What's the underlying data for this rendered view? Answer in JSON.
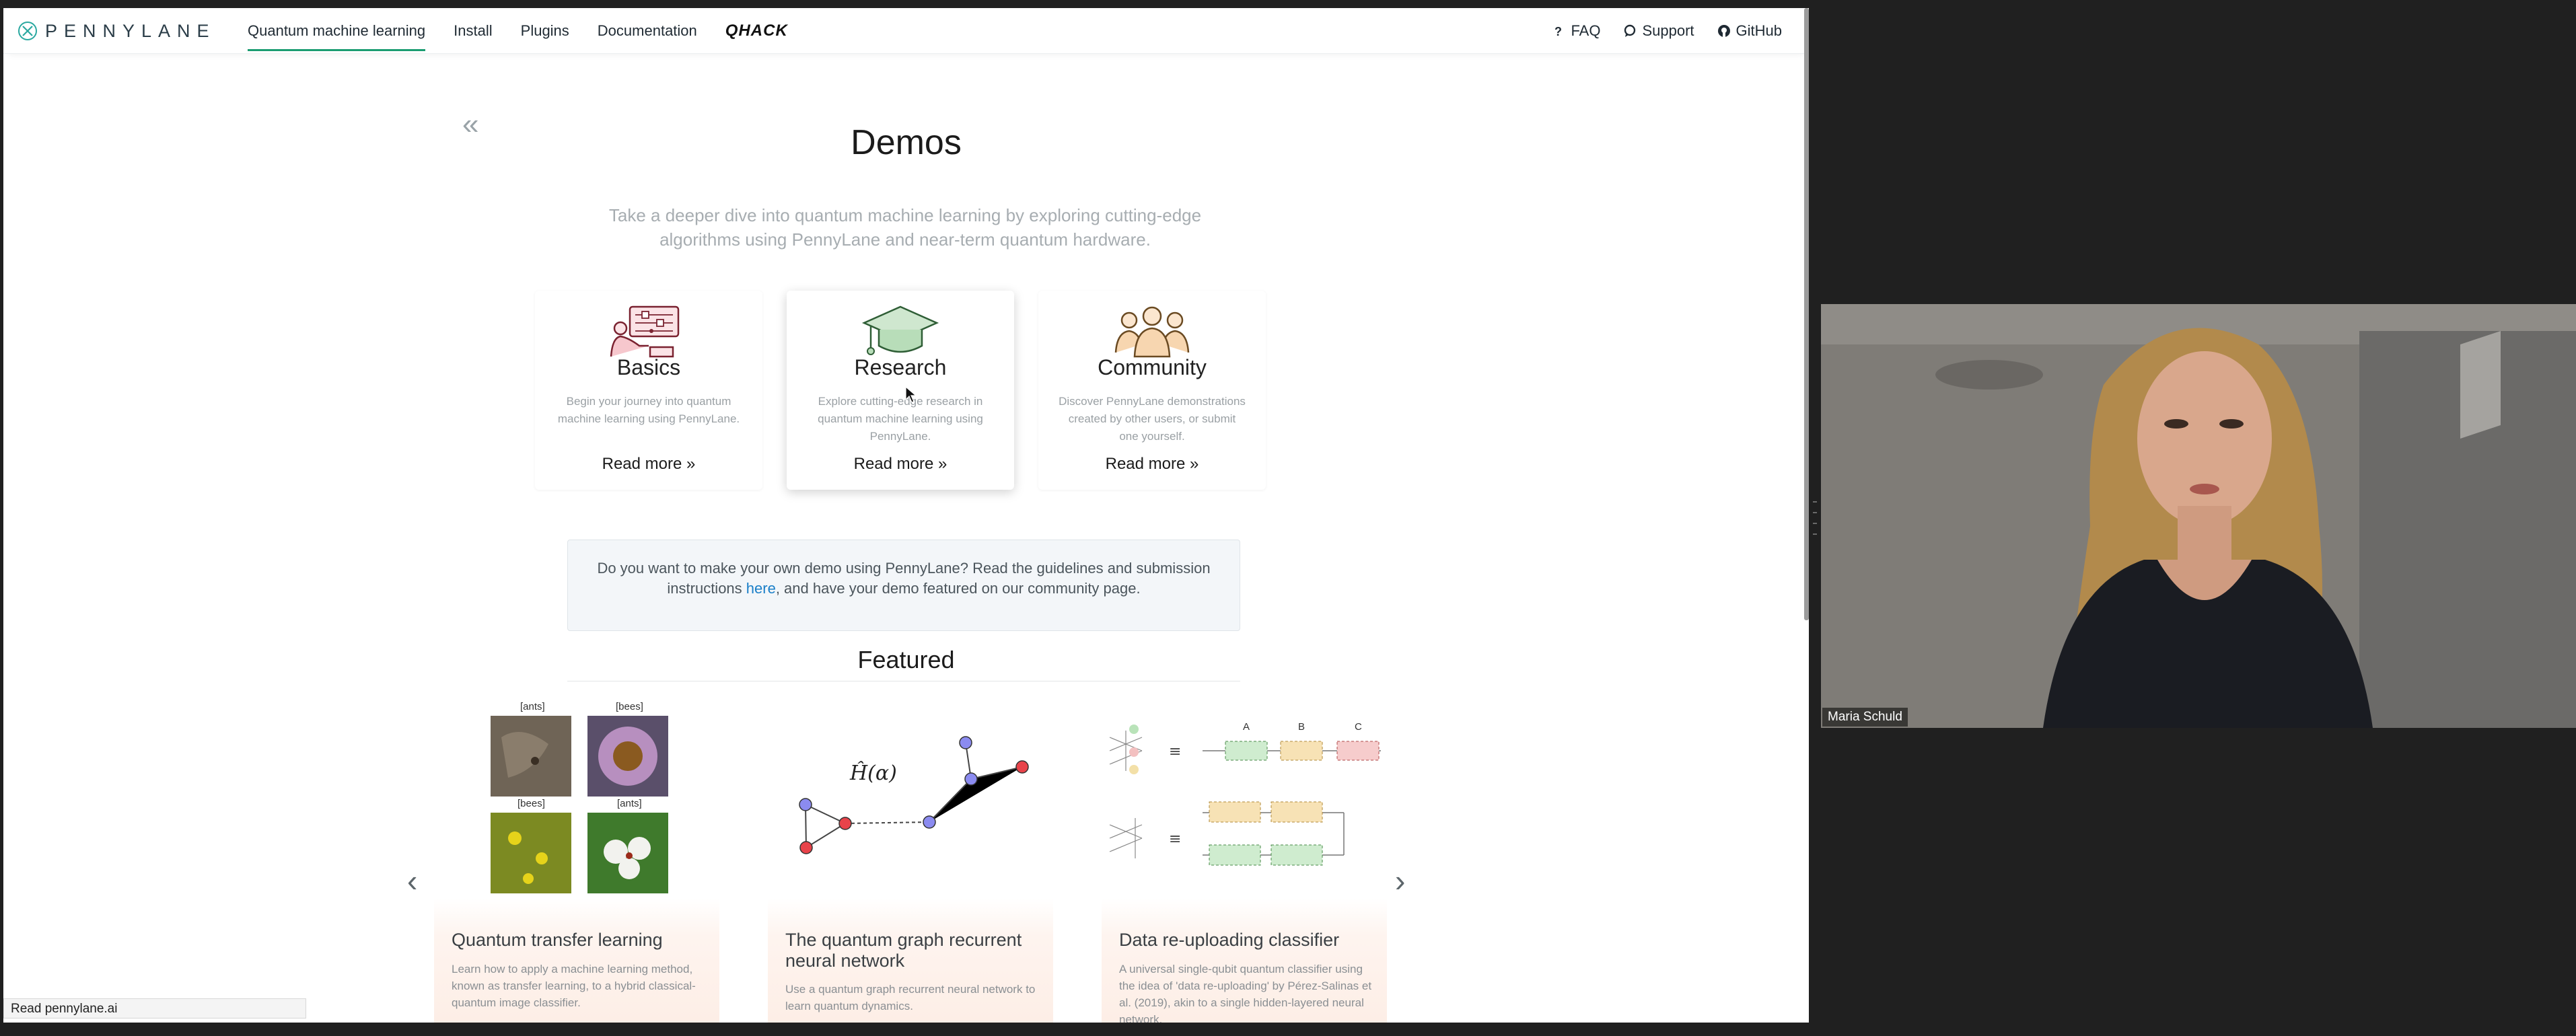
{
  "browser": {
    "nav": {
      "logo_text": "PENNYLANE",
      "links": [
        "Quantum machine learning",
        "Install",
        "Plugins",
        "Documentation"
      ],
      "qhack": "QHACK",
      "right": [
        "FAQ",
        "Support",
        "GitHub"
      ]
    },
    "page": {
      "back": "«",
      "title": "Demos",
      "subtitle": "Take a deeper dive into quantum machine learning by exploring cutting-edge algorithms using PennyLane and near-term quantum hardware.",
      "categories": [
        {
          "title": "Basics",
          "desc": "Begin your journey into quantum machine learning using PennyLane.",
          "more": "Read more »",
          "icon": "circuit-person-icon"
        },
        {
          "title": "Research",
          "desc": "Explore cutting-edge research in quantum machine learning using PennyLane.",
          "more": "Read more »",
          "icon": "graduation-cap-icon"
        },
        {
          "title": "Community",
          "desc": "Discover PennyLane demonstrations created by other users, or submit one yourself.",
          "more": "Read more »",
          "icon": "people-icon"
        }
      ],
      "notice_before": "Do you want to make your own demo using PennyLane? Read the guidelines and submission instructions ",
      "notice_link": "here",
      "notice_after": ", and have your demo featured on our community page.",
      "featured": "Featured",
      "demos": [
        {
          "title": "Quantum transfer learning",
          "desc": "Learn how to apply a machine learning method, known as transfer learning, to a hybrid classical-quantum image classifier.",
          "labels": [
            "[ants]",
            "[bees]",
            "[bees]",
            "[ants]"
          ]
        },
        {
          "title": "The quantum graph recurrent neural network",
          "desc": "Use a quantum graph recurrent neural network to learn quantum dynamics.",
          "formula": "Ĥ(α)"
        },
        {
          "title": "Data re-uploading classifier",
          "desc": "A universal single-qubit quantum classifier using the idea of 'data re-uploading' by Pérez-Salinas et al. (2019), akin to a single hidden-layered neural network.",
          "col_labels": [
            "A",
            "B",
            "C"
          ]
        }
      ]
    },
    "status": "Read pennylane.ai"
  },
  "video": {
    "participant_name": "Maria Schuld"
  },
  "colors": {
    "accent_green": "#1a9c71",
    "link_blue": "#1a7fc8"
  }
}
